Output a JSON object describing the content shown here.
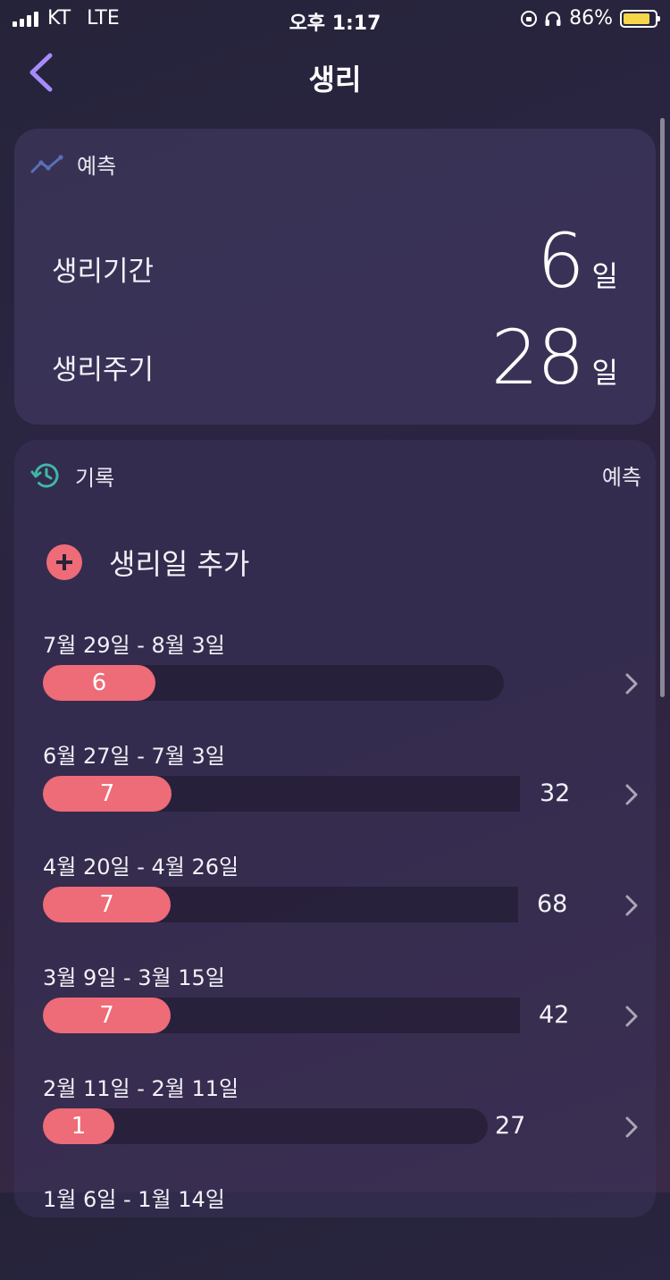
{
  "status_bar": {
    "carrier": "KT",
    "network": "LTE",
    "time": "오후 1:17",
    "battery": "86%",
    "battery_level": 0.86
  },
  "nav": {
    "title": "생리"
  },
  "prediction": {
    "header": "예측",
    "period_label": "생리기간",
    "period_value": "6",
    "period_unit": "일",
    "cycle_label": "생리주기",
    "cycle_value": "28",
    "cycle_unit": "일"
  },
  "history": {
    "header": "기록",
    "prediction_link": "예측",
    "add_label": "생리일 추가",
    "entries": [
      {
        "date": "7월 29일 - 8월 3일",
        "days": "6",
        "cycle": ""
      },
      {
        "date": "6월 27일 - 7월 3일",
        "days": "7",
        "cycle": "32"
      },
      {
        "date": "4월 20일 - 4월 26일",
        "days": "7",
        "cycle": "68"
      },
      {
        "date": "3월 9일 - 3월 15일",
        "days": "7",
        "cycle": "42"
      },
      {
        "date": "2월 11일 - 2월 11일",
        "days": "1",
        "cycle": "27"
      },
      {
        "date": "1월 6일 - 1월 14일",
        "days": "",
        "cycle": ""
      }
    ]
  },
  "colors": {
    "accent_pink": "#ee6b78",
    "back_arrow": "#a78bfa",
    "history_icon": "#3fb7a5",
    "trend_icon": "#5a6fb8"
  }
}
